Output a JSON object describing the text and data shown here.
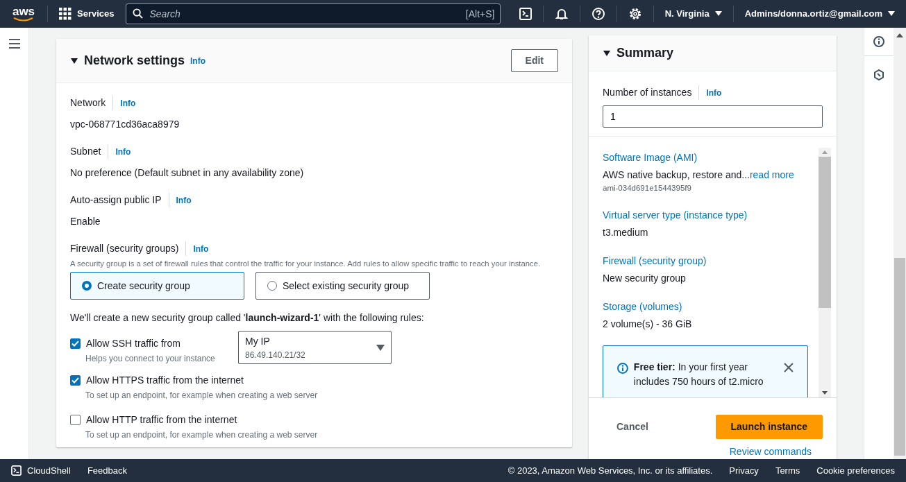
{
  "top_nav": {
    "logo": "aws",
    "services": "Services",
    "search": {
      "placeholder": "Search",
      "shortcut": "[Alt+S]"
    },
    "region": "N. Virginia",
    "account": "Admins/donna.ortiz@gmail.com"
  },
  "network_settings": {
    "expanded": true,
    "title": "Network settings",
    "info": "Info",
    "edit_button": "Edit",
    "fields": [
      {
        "label": "Network",
        "info": "Info",
        "value": "vpc-068771cd36aca8979"
      },
      {
        "label": "Subnet",
        "info": "Info",
        "value": "No preference (Default subnet in any availability zone)"
      },
      {
        "label": "Auto-assign public IP",
        "info": "Info",
        "value": "Enable"
      }
    ],
    "firewall": {
      "label": "Firewall (security groups)",
      "info": "Info",
      "description": "A security group is a set of firewall rules that control the traffic for your instance. Add rules to allow specific traffic to reach your instance.",
      "options": [
        {
          "label": "Create security group",
          "selected": true
        },
        {
          "label": "Select existing security group",
          "selected": false
        }
      ],
      "rules_intro": "We'll create a new security group called '**launch-wizard-1**' with the following rules:",
      "rules": [
        {
          "label": "Allow SSH traffic from",
          "hint": "Helps you connect to your instance",
          "checked": true,
          "source": {
            "value": "My IP",
            "detail": "86.49.140.21/32"
          }
        },
        {
          "label": "Allow HTTPS traffic from the internet",
          "hint": "To set up an endpoint, for example when creating a web server",
          "checked": true
        },
        {
          "label": "Allow HTTP traffic from the internet",
          "hint": "To set up an endpoint, for example when creating a web server",
          "checked": false
        }
      ]
    }
  },
  "summary": {
    "expanded": true,
    "title": "Summary",
    "instances": {
      "label": "Number of instances",
      "info": "Info",
      "value": "1"
    },
    "items": [
      {
        "label": "Software Image (AMI)",
        "value": "AWS native backup, restore and...",
        "link": "read more",
        "detail": "ami-034d691e1544395f9"
      },
      {
        "label": "Virtual server type (instance type)",
        "value": "t3.medium"
      },
      {
        "label": "Firewall (security group)",
        "value": "New security group"
      },
      {
        "label": "Storage (volumes)",
        "value": "2 volume(s) - 36 GiB"
      }
    ],
    "notice": {
      "text": "**Free tier:** In your first year includes 750 hours of t2.micro"
    },
    "cancel_button": "Cancel",
    "launch_button": "Launch instance",
    "review_link": "Review commands"
  },
  "footer": {
    "cloudshell": "CloudShell",
    "feedback": "Feedback",
    "copyright": "© 2023, Amazon Web Services, Inc. or its affiliates.",
    "links": [
      "Privacy",
      "Terms",
      "Cookie preferences"
    ]
  }
}
